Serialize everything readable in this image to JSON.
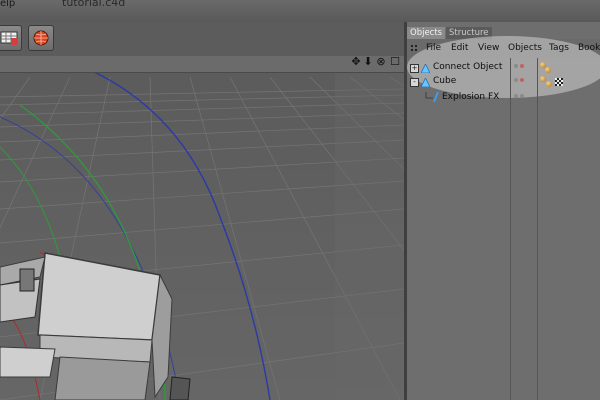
{
  "window": {
    "menu_fragment": "elp",
    "doc_title": "tutorial.c4d"
  },
  "toolbar": {
    "buttons": [
      {
        "icon": "render-settings-icon"
      },
      {
        "icon": "render-sphere-icon"
      }
    ]
  },
  "viewport": {
    "nav_icons": [
      "move-icon",
      "dolly-icon",
      "rotate-icon",
      "maximize-icon"
    ]
  },
  "panel": {
    "tabs": [
      "Objects",
      "Structure"
    ],
    "menu": [
      "File",
      "Edit",
      "View",
      "Objects",
      "Tags",
      "Book"
    ],
    "objects": [
      {
        "name": "Connect Object",
        "expander": "+",
        "icon": "connect-icon"
      },
      {
        "name": "Cube",
        "expander": "-",
        "icon": "cube-icon"
      },
      {
        "name": "Explosion FX",
        "expander": "",
        "icon": "explosion-icon"
      }
    ]
  },
  "colors": {
    "accent_icon": "#3aa0ff",
    "grid": "#747474",
    "axis_blue": "#2a3aa8",
    "axis_green": "#2f9a3a",
    "axis_red": "#b02a2a"
  }
}
